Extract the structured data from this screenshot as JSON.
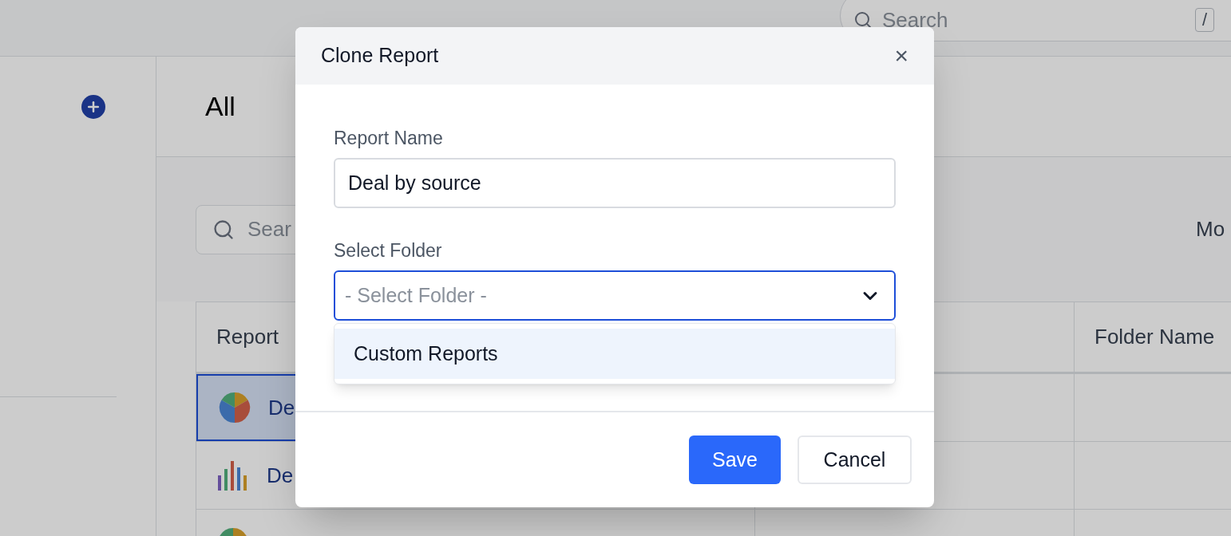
{
  "topbar": {
    "search": {
      "placeholder": "Search"
    },
    "shortcut": "/"
  },
  "main": {
    "title": "All",
    "search": {
      "placeholder": "Sear"
    },
    "toolbar_label": "Mo",
    "table": {
      "columns": [
        {
          "label": "Report"
        },
        {
          "label": "Folder Name"
        }
      ],
      "rows": [
        {
          "name": "De",
          "kind": "pie",
          "selected": true
        },
        {
          "name": "De",
          "kind": "bar",
          "selected": false
        },
        {
          "kind": "pie",
          "selected": false
        }
      ]
    }
  },
  "dialog": {
    "title": "Clone Report",
    "close": "×",
    "fields": [
      {
        "kind": "text",
        "label": "Report Name",
        "value": "Deal by source"
      },
      {
        "kind": "select",
        "label": "Select Folder",
        "placeholder": "- Select Folder -",
        "expanded": true,
        "options": [
          {
            "label": "Custom Reports",
            "selected": true
          }
        ]
      }
    ],
    "buttons": [
      {
        "label": "Save",
        "kind": "primary"
      },
      {
        "label": "Cancel",
        "kind": "secondary"
      }
    ]
  }
}
